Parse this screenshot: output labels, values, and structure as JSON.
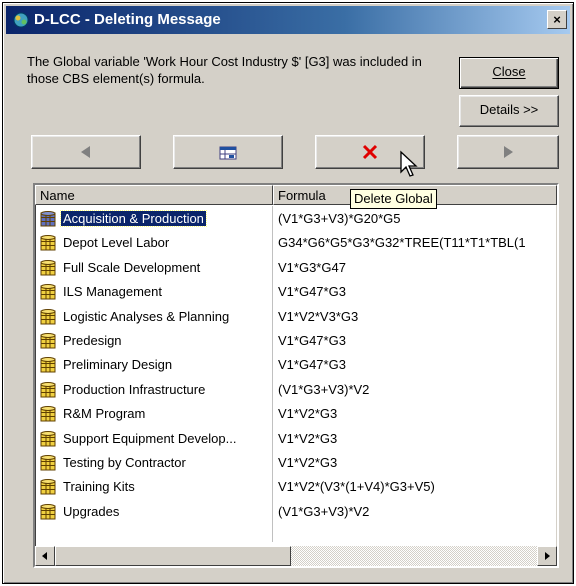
{
  "window": {
    "title": "D-LCC - Deleting Message",
    "close_glyph": "×"
  },
  "message": "The Global variable 'Work Hour Cost Industry $' [G3] was included in those CBS element(s) formula.",
  "buttons": {
    "close": "Close",
    "details": "Details >>"
  },
  "icons": {
    "app": "dlcc-app-icon",
    "prev": "left-arrow-icon",
    "grid": "table-icon",
    "delete": "red-x-icon",
    "next": "right-arrow-icon",
    "row": "database-icon"
  },
  "colors": {
    "title_bar": "#0a246a",
    "selection": "#0a246a",
    "delete_red": "#e00000",
    "tooltip_bg": "#ffffe1"
  },
  "tooltip": "Delete Global",
  "list": {
    "columns": [
      "Name",
      "Formula"
    ],
    "rows": [
      {
        "name": "Acquisition & Production",
        "formula": "(V1*G3+V3)*G20*G5",
        "selected": true
      },
      {
        "name": "Depot Level Labor",
        "formula": "G34*G6*G5*G3*G32*TREE(T11*T1*TBL(1"
      },
      {
        "name": "Full Scale Development",
        "formula": "V1*G3*G47"
      },
      {
        "name": "ILS Management",
        "formula": "V1*G47*G3"
      },
      {
        "name": "Logistic Analyses & Planning",
        "formula": "V1*V2*V3*G3"
      },
      {
        "name": "Predesign",
        "formula": "V1*G47*G3"
      },
      {
        "name": "Preliminary Design",
        "formula": "V1*G47*G3"
      },
      {
        "name": "Production Infrastructure",
        "formula": "(V1*G3+V3)*V2"
      },
      {
        "name": "R&M Program",
        "formula": "V1*V2*G3"
      },
      {
        "name": "Support Equipment Develop...",
        "formula": "V1*V2*G3"
      },
      {
        "name": "Testing by Contractor",
        "formula": "V1*V2*G3"
      },
      {
        "name": "Training Kits",
        "formula": "V1*V2*(V3*(1+V4)*G3+V5)"
      },
      {
        "name": "Upgrades",
        "formula": "(V1*G3+V3)*V2"
      }
    ]
  }
}
